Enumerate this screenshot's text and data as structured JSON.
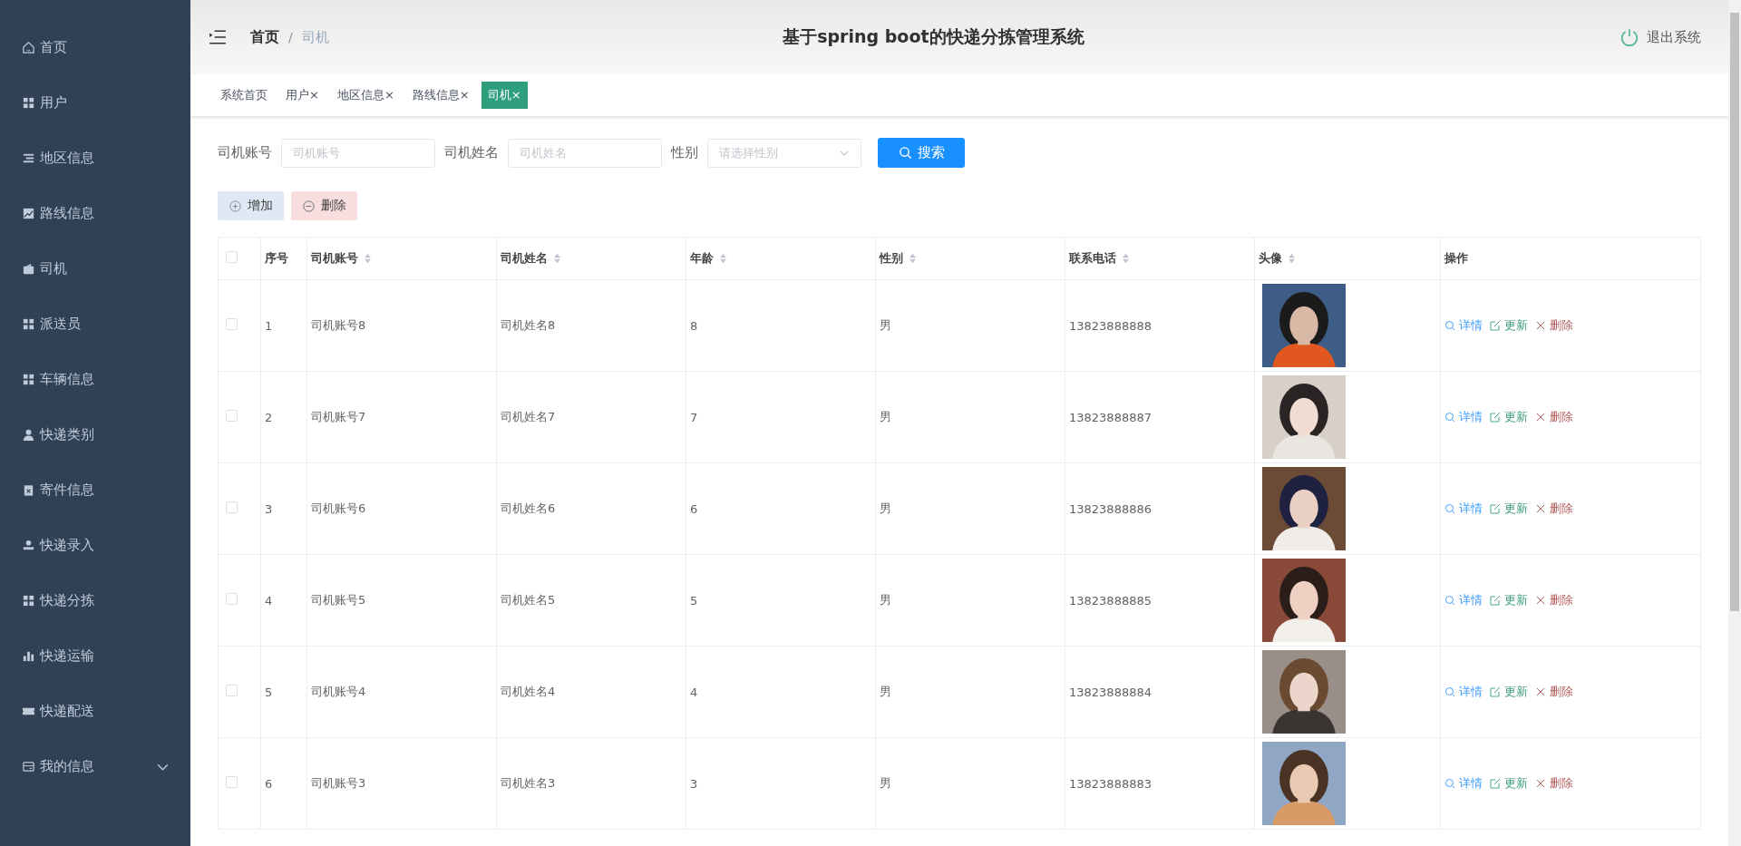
{
  "sidebar": {
    "items": [
      {
        "label": "首页",
        "selected": false
      },
      {
        "label": "用户",
        "selected": false
      },
      {
        "label": "地区信息",
        "selected": false
      },
      {
        "label": "路线信息",
        "selected": false
      },
      {
        "label": "司机",
        "selected": false
      },
      {
        "label": "派送员",
        "selected": false
      },
      {
        "label": "车辆信息",
        "selected": false
      },
      {
        "label": "快递类别",
        "selected": false
      },
      {
        "label": "寄件信息",
        "selected": false
      },
      {
        "label": "快递录入",
        "selected": false
      },
      {
        "label": "快递分拣",
        "selected": false
      },
      {
        "label": "快递运输",
        "selected": false
      },
      {
        "label": "快递配送",
        "selected": false
      },
      {
        "label": "我的信息",
        "selected": false,
        "expanded": false
      }
    ]
  },
  "header": {
    "breadcrumb": [
      "首页",
      "司机"
    ],
    "separator": "/",
    "title": "基于spring boot的快递分拣管理系统",
    "logout": "退出系统"
  },
  "tabs": [
    {
      "label": "系统首页",
      "selected": false
    },
    {
      "label": "用户",
      "close": "×",
      "selected": false
    },
    {
      "label": "地区信息",
      "close": "×",
      "selected": false
    },
    {
      "label": "路线信息",
      "close": "×",
      "selected": false
    },
    {
      "label": "司机",
      "close": "×",
      "selected": true
    }
  ],
  "search": {
    "fields": [
      {
        "label": "司机账号",
        "placeholder": "司机账号",
        "kind": "input"
      },
      {
        "label": "司机姓名",
        "placeholder": "司机姓名",
        "kind": "input"
      },
      {
        "label": "性别",
        "placeholder": "请选择性别",
        "kind": "select"
      }
    ],
    "button": "搜索"
  },
  "actions": {
    "add": "增加",
    "delete": "删除"
  },
  "table": {
    "header_checked": false,
    "columns": [
      {
        "label": "序号",
        "sortable": false
      },
      {
        "label": "司机账号",
        "sortable": true
      },
      {
        "label": "司机姓名",
        "sortable": true
      },
      {
        "label": "年龄",
        "sortable": true
      },
      {
        "label": "性别",
        "sortable": true
      },
      {
        "label": "联系电话",
        "sortable": true
      },
      {
        "label": "头像",
        "sortable": true
      },
      {
        "label": "操作",
        "sortable": false
      }
    ],
    "rows": [
      {
        "checked": false,
        "cells": [
          "1",
          "司机账号8",
          "司机姓名8",
          "8",
          "男",
          "13823888888"
        ],
        "actions": [
          "详情",
          "更新",
          "删除"
        ]
      },
      {
        "checked": false,
        "cells": [
          "2",
          "司机账号7",
          "司机姓名7",
          "7",
          "男",
          "13823888887"
        ],
        "actions": [
          "详情",
          "更新",
          "删除"
        ]
      },
      {
        "checked": false,
        "cells": [
          "3",
          "司机账号6",
          "司机姓名6",
          "6",
          "男",
          "13823888886"
        ],
        "actions": [
          "详情",
          "更新",
          "删除"
        ]
      },
      {
        "checked": false,
        "cells": [
          "4",
          "司机账号5",
          "司机姓名5",
          "5",
          "男",
          "13823888885"
        ],
        "actions": [
          "详情",
          "更新",
          "删除"
        ]
      },
      {
        "checked": false,
        "cells": [
          "5",
          "司机账号4",
          "司机姓名4",
          "4",
          "男",
          "13823888884"
        ],
        "actions": [
          "详情",
          "更新",
          "删除"
        ]
      },
      {
        "checked": false,
        "cells": [
          "6",
          "司机账号3",
          "司机姓名3",
          "3",
          "男",
          "13823888883"
        ],
        "actions": [
          "详情",
          "更新",
          "删除"
        ]
      }
    ]
  }
}
